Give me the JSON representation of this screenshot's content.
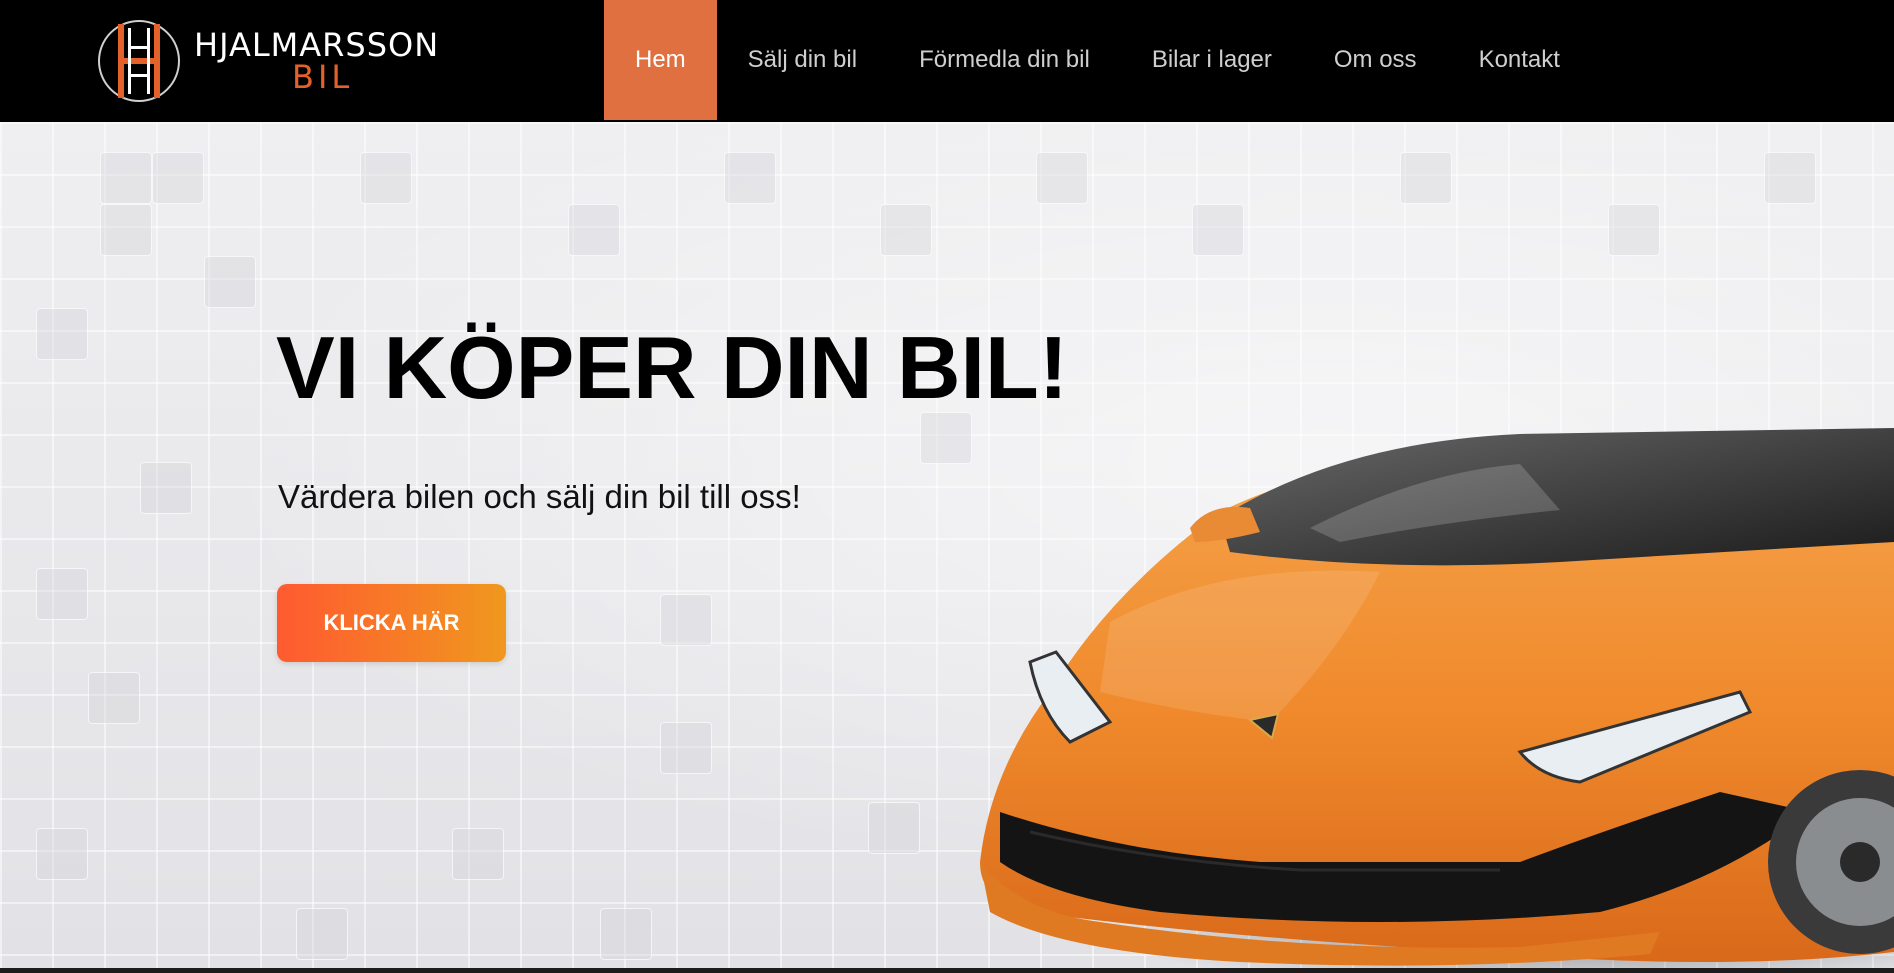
{
  "brand": {
    "logo_monogram": "H",
    "name": "HJALMARSSON",
    "sub": "BIL",
    "accent_color": "#e2622a"
  },
  "nav": {
    "items": [
      {
        "label": "Hem",
        "active": true
      },
      {
        "label": "Sälj din bil",
        "active": false
      },
      {
        "label": "Förmedla din bil",
        "active": false
      },
      {
        "label": "Bilar i lager",
        "active": false
      },
      {
        "label": "Om oss",
        "active": false
      },
      {
        "label": "Kontakt",
        "active": false
      }
    ],
    "active_color": "#e07040"
  },
  "hero": {
    "title": "VI KÖPER DIN BIL!",
    "subtitle": "Värdera bilen och sälj din bil till oss!",
    "cta_label": "KLICKA HÄR",
    "image": "orange-sports-car"
  }
}
